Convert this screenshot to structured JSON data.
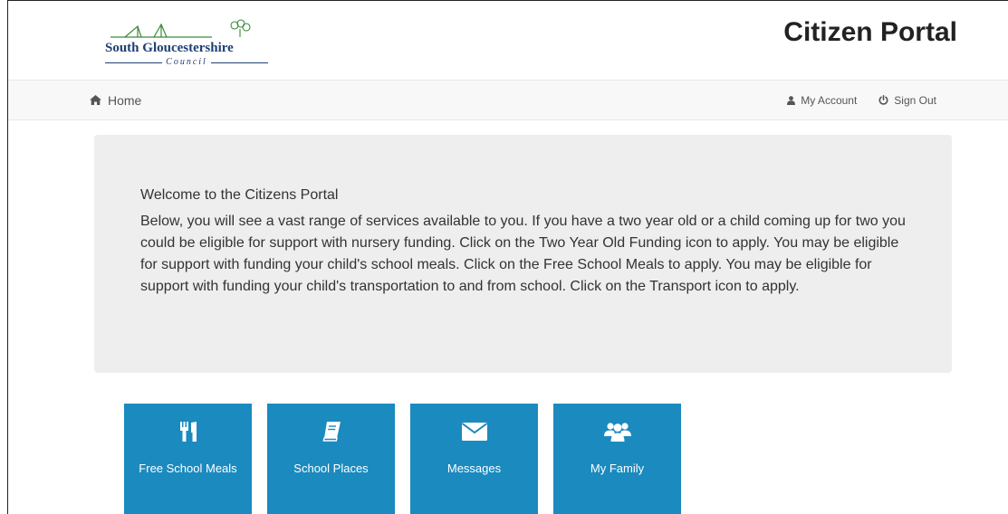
{
  "header": {
    "logo": {
      "name": "South Gloucestershire",
      "sub": "Council"
    },
    "title": "Citizen Portal"
  },
  "nav": {
    "home": {
      "label": "Home",
      "icon": "home-icon"
    },
    "my_account": {
      "label": "My Account",
      "icon": "user-icon"
    },
    "sign_out": {
      "label": "Sign Out",
      "icon": "power-icon"
    }
  },
  "welcome": {
    "heading": "Welcome to the Citizens Portal",
    "body": "Below, you will see a vast range of services available to you. If you have a two year old or a child coming up for two you could be eligible for support with nursery funding. Click on the Two Year Old Funding icon to apply. You may be eligible for support with funding your child's school meals. Click on the Free School Meals to apply. You may be eligible for support with funding your child's transportation to and from school. Click on the Transport icon to apply."
  },
  "tiles": [
    {
      "label": "Free School Meals",
      "icon": "cutlery-icon"
    },
    {
      "label": "School Places",
      "icon": "book-icon"
    },
    {
      "label": "Messages",
      "icon": "envelope-icon"
    },
    {
      "label": "My Family",
      "icon": "users-icon"
    }
  ],
  "colors": {
    "tile_background": "#1b8abf",
    "panel_background": "#eeeeee",
    "navbar_background": "#f8f8f8",
    "logo_blue": "#1f3f73",
    "logo_green": "#3a8a3a"
  }
}
